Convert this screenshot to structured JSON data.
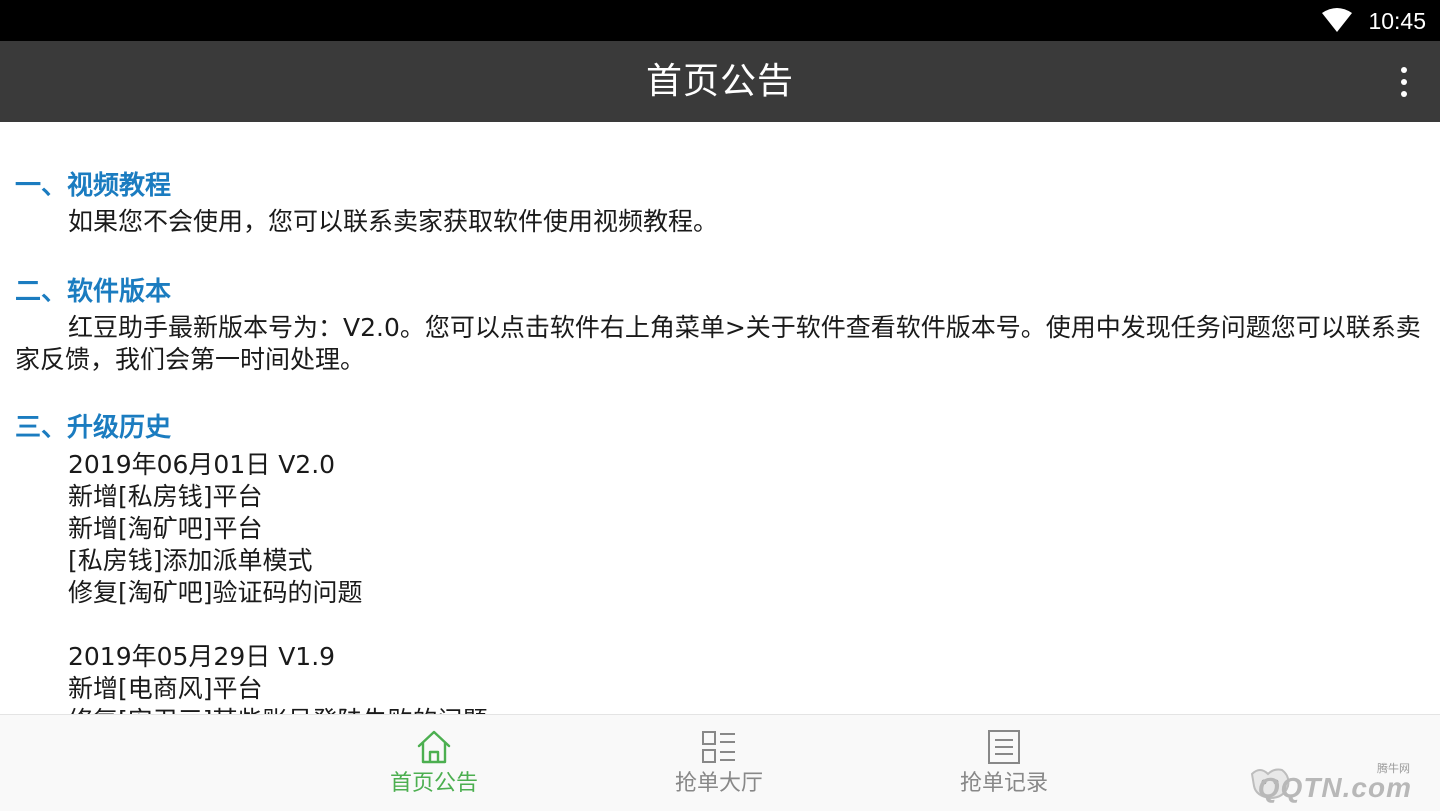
{
  "status_bar": {
    "time": "10:45"
  },
  "app_bar": {
    "title": "首页公告"
  },
  "sections": {
    "video": {
      "heading": "一、视频教程",
      "body": "如果您不会使用，您可以联系卖家获取软件使用视频教程。"
    },
    "version": {
      "heading": "二、软件版本",
      "body": "红豆助手最新版本号为：V2.0。您可以点击软件右上角菜单>关于软件查看软件版本号。使用中发现任务问题您可以联系卖家反馈，我们会第一时间处理。"
    },
    "history": {
      "heading": "三、升级历史",
      "entries": [
        {
          "title": "2019年06月01日 V2.0",
          "lines": [
            "新增[私房钱]平台",
            "新增[淘矿吧]平台",
            "[私房钱]添加派单模式",
            "修复[淘矿吧]验证码的问题"
          ]
        },
        {
          "title": "2019年05月29日 V1.9",
          "lines": [
            "新增[电商风]平台",
            "修复[安卫三]某些账号登陆失败的问题"
          ]
        }
      ]
    }
  },
  "bottom_nav": {
    "items": [
      {
        "label": "首页公告",
        "icon": "home-icon",
        "active": true
      },
      {
        "label": "抢单大厅",
        "icon": "grid-list-icon",
        "active": false
      },
      {
        "label": "抢单记录",
        "icon": "document-list-icon",
        "active": false
      }
    ]
  },
  "watermark": {
    "small": "腾牛网",
    "big": "QQTN.com"
  },
  "colors": {
    "accent_green": "#4caf50",
    "heading_blue": "#1b7cc0",
    "appbar": "#3a3a3a"
  }
}
